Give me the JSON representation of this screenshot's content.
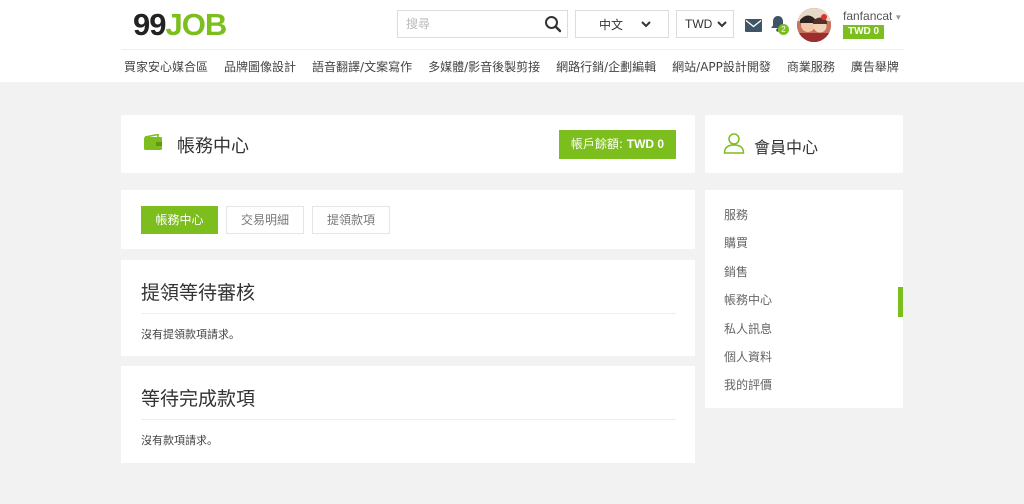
{
  "header": {
    "logo": {
      "left": "99",
      "right": "JOB"
    },
    "search": {
      "placeholder": "搜尋",
      "value": ""
    },
    "language": "中文",
    "currency": "TWD",
    "notification_count": "2",
    "user": {
      "name": "fanfancat",
      "balance": "TWD 0"
    }
  },
  "nav": {
    "items": [
      "買家安心媒合區",
      "品牌圖像設計",
      "語音翻譯/文案寫作",
      "多媒體/影音後製剪接",
      "網路行銷/企劃編輯",
      "網站/APP設計開發",
      "商業服務",
      "廣告舉牌"
    ]
  },
  "main": {
    "title": "帳務中心",
    "balance_button": {
      "label": "帳戶餘額:",
      "amount": "TWD 0"
    },
    "tabs": [
      {
        "label": "帳務中心",
        "active": true
      },
      {
        "label": "交易明細",
        "active": false
      },
      {
        "label": "提領款項",
        "active": false
      }
    ],
    "sections": [
      {
        "title": "提領等待審核",
        "message": "沒有提領款項請求。"
      },
      {
        "title": "等待完成款項",
        "message": "沒有款項請求。"
      }
    ]
  },
  "sidebar": {
    "title": "會員中心",
    "items": [
      {
        "label": "服務",
        "active": false
      },
      {
        "label": "購買",
        "active": false
      },
      {
        "label": "銷售",
        "active": false
      },
      {
        "label": "帳務中心",
        "active": true
      },
      {
        "label": "私人訊息",
        "active": false
      },
      {
        "label": "個人資料",
        "active": false
      },
      {
        "label": "我的評價",
        "active": false
      }
    ]
  },
  "colors": {
    "accent": "#7cbe1e",
    "page_bg": "#f2f2f2",
    "card_bg": "#ffffff"
  },
  "icons": [
    "search-icon",
    "chevron-down-icon",
    "mail-icon",
    "bell-icon",
    "wallet-icon",
    "user-icon"
  ]
}
